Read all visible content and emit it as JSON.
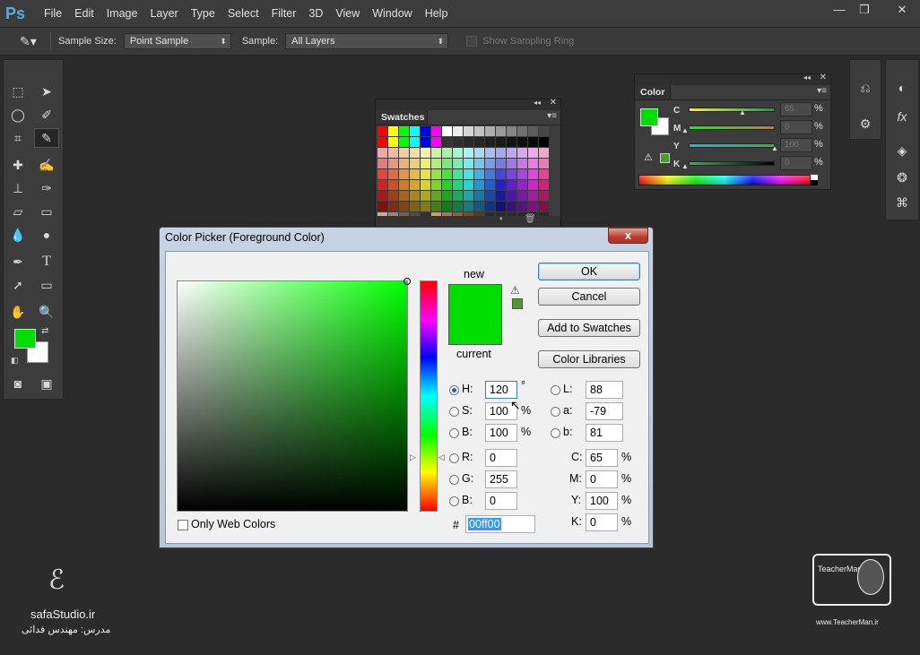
{
  "app": {
    "logo": "Ps"
  },
  "menu": [
    "File",
    "Edit",
    "Image",
    "Layer",
    "Type",
    "Select",
    "Filter",
    "3D",
    "View",
    "Window",
    "Help"
  ],
  "window_controls": {
    "minimize": "—",
    "restore": "❐",
    "close": "✕"
  },
  "options": {
    "sample_size_label": "Sample Size:",
    "sample_size_value": "Point Sample",
    "sample_label": "Sample:",
    "sample_value": "All Layers",
    "show_ring_label": "Show Sampling Ring"
  },
  "swatches_panel": {
    "title": "Swatches"
  },
  "color_panel": {
    "title": "Color",
    "rows": [
      {
        "label": "C",
        "value": "65",
        "unit": "%"
      },
      {
        "label": "M",
        "value": "0",
        "unit": "%"
      },
      {
        "label": "Y",
        "value": "100",
        "unit": "%"
      },
      {
        "label": "K",
        "value": "0",
        "unit": "%"
      }
    ]
  },
  "dialog": {
    "title": "Color Picker (Foreground Color)",
    "close": "x",
    "new_label": "new",
    "current_label": "current",
    "buttons": {
      "ok": "OK",
      "cancel": "Cancel",
      "add": "Add to Swatches",
      "libraries": "Color Libraries"
    },
    "only_web": "Only Web Colors",
    "hsb": [
      {
        "label": "H:",
        "value": "120",
        "unit": "°",
        "selected": true
      },
      {
        "label": "S:",
        "value": "100",
        "unit": "%"
      },
      {
        "label": "B:",
        "value": "100",
        "unit": "%"
      }
    ],
    "rgb": [
      {
        "label": "R:",
        "value": "0"
      },
      {
        "label": "G:",
        "value": "255"
      },
      {
        "label": "B:",
        "value": "0"
      }
    ],
    "lab": [
      {
        "label": "L:",
        "value": "88"
      },
      {
        "label": "a:",
        "value": "-79"
      },
      {
        "label": "b:",
        "value": "81"
      }
    ],
    "cmyk": [
      {
        "label": "C:",
        "value": "65",
        "unit": "%"
      },
      {
        "label": "M:",
        "value": "0",
        "unit": "%"
      },
      {
        "label": "Y:",
        "value": "100",
        "unit": "%"
      },
      {
        "label": "K:",
        "value": "0",
        "unit": "%"
      }
    ],
    "hex_label": "#",
    "hex_value": "00ff00"
  },
  "colors": {
    "foreground": "#00dd00",
    "background": "#ffffff",
    "selected_color": "#00dd00"
  },
  "watermark": {
    "studio": "safaStudio.ir",
    "teacher": "مدرس: مهندس فدائی",
    "site": "www.TeacherMan.ir",
    "logo_text": "TeacherMan"
  }
}
